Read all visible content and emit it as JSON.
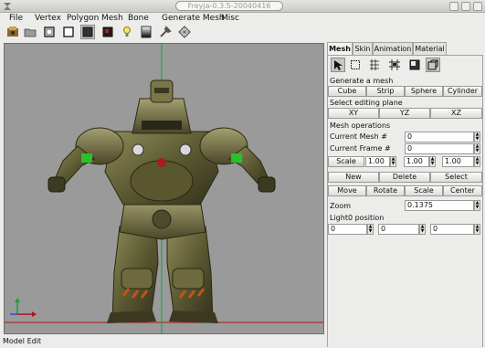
{
  "window": {
    "title": "Freyja-0.3.5-20040416"
  },
  "menu": [
    "File",
    "Vertex",
    "Polygon",
    "Mesh",
    "Bone",
    "Generate Mesh",
    "Misc"
  ],
  "toolbar": {
    "icons": [
      "app-icon",
      "open-icon",
      "restore-icon",
      "view-icon",
      "solid-view-icon",
      "texture-view-icon",
      "light-icon",
      "gradient-icon",
      "tool-icon",
      "wireframe-icon"
    ]
  },
  "status": {
    "text": "Model Edit"
  },
  "panel": {
    "tabs": [
      "Mesh",
      "Skin",
      "Animation",
      "Material"
    ],
    "active_tab": "Mesh",
    "generate_label": "Generate a mesh",
    "generate_buttons": [
      "Cube",
      "Strip",
      "Sphere",
      "Cylinder"
    ],
    "plane_label": "Select editing plane",
    "plane_buttons": [
      "XY",
      "YZ",
      "XZ"
    ],
    "ops_label": "Mesh operations",
    "current_mesh_label": "Current Mesh #",
    "current_mesh_value": "0",
    "current_frame_label": "Current Frame #",
    "current_frame_value": "0",
    "scale_button": "Scale",
    "scale_values": [
      "1.00",
      "1.00",
      "1.00"
    ],
    "ops_row1": [
      "New",
      "Delete",
      "Select"
    ],
    "ops_row2": [
      "Move",
      "Rotate",
      "Scale",
      "Center"
    ],
    "zoom_label": "Zoom",
    "zoom_value": "0.1375",
    "light_label": "Light0 position",
    "light_values": [
      "0",
      "0",
      "0"
    ]
  },
  "colors": {
    "viewport_bg": "#9a9a9a",
    "grid_x": "#b01414",
    "grid_y": "#13a23a"
  }
}
